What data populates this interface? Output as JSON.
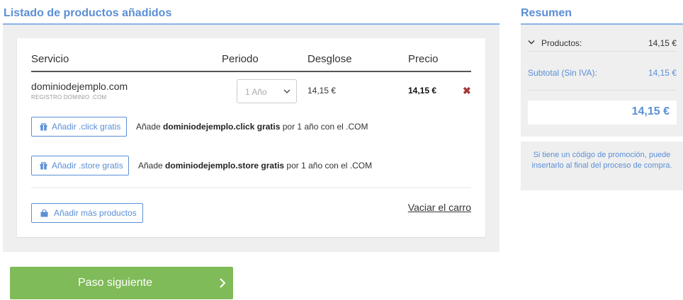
{
  "left": {
    "title": "Listado de productos añadidos",
    "table": {
      "headers": {
        "servicio": "Servicio",
        "periodo": "Periodo",
        "desglose": "Desglose",
        "precio": "Precio"
      },
      "row": {
        "domain": "dominiodejemplo.com",
        "subtitle": "REGISTRO DOMINIO .COM",
        "period": "1 Año",
        "desglose": "14,15 €",
        "precio": "14,15 €",
        "remove": "✖"
      }
    },
    "promos": [
      {
        "button": "Añadir .click gratis",
        "pre": "Añade ",
        "bold": "dominiodejemplo.click gratis",
        "post": " por 1 año con el .COM"
      },
      {
        "button": "Añadir .store gratis",
        "pre": "Añade ",
        "bold": "dominiodejemplo.store gratis",
        "post": " por 1 año con el .COM"
      }
    ],
    "add_more": "Añadir más productos",
    "empty_cart": "Vaciar el carro"
  },
  "next_button": "Paso siguiente",
  "summary": {
    "title": "Resumen",
    "products_label": "Productos:",
    "products_value": "14,15 €",
    "subtotal_label": "Subtotal (Sin IVA):",
    "subtotal_value": "14,15 €",
    "total": "14,15 €",
    "promo_note": "Si tiene un código de promoción, puede insertarlo al final del proceso de compra."
  },
  "colors": {
    "accent": "#5b8fd6",
    "next": "#7fbb58",
    "remove": "#a33b3b"
  }
}
